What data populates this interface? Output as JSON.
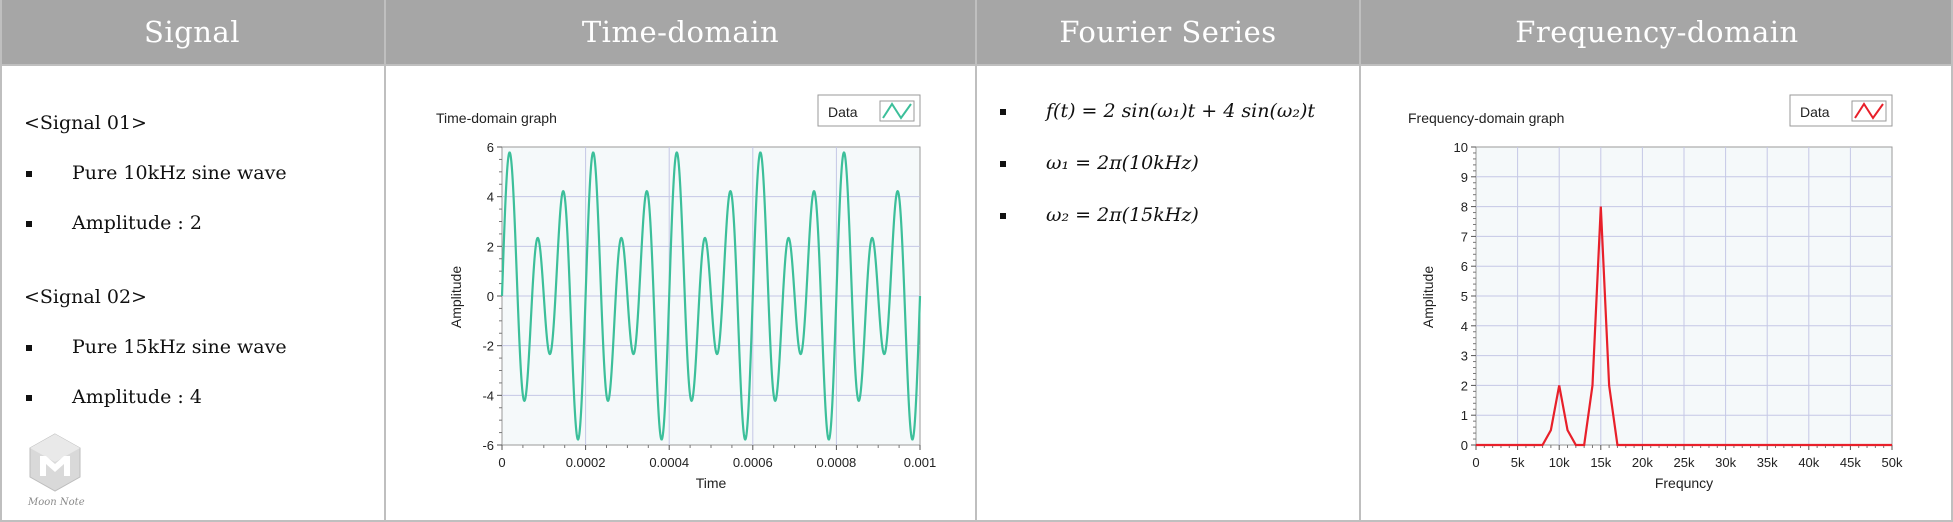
{
  "headers": {
    "signal": "Signal",
    "time_domain": "Time-domain",
    "fourier": "Fourier Series",
    "frequency_domain": "Frequency-domain"
  },
  "signals": {
    "s1_title": "<Signal 01>",
    "s1_items": [
      "Pure 10kHz sine wave",
      "Amplitude : 2"
    ],
    "s2_title": "<Signal 02>",
    "s2_items": [
      "Pure 15kHz sine wave",
      "Amplitude : 4"
    ]
  },
  "fourier": {
    "eq1": "f(t) = 2 sin(ω₁)t + 4 sin(ω₂)t",
    "eq2": "ω₁ = 2π(10kHz)",
    "eq3": "ω₂ = 2π(15kHz)"
  },
  "logo_text": "Moon Note",
  "colors": {
    "header_bg": "#a6a6a6",
    "time_series": "#3cbf9a",
    "freq_series": "#e8202a",
    "plot_bg": "#f5f9fa",
    "grid": "#c5c8e6"
  },
  "chart_data": [
    {
      "type": "line",
      "title": "Time-domain graph",
      "xlabel": "Time",
      "ylabel": "Amplitude",
      "xlim": [
        0,
        0.001
      ],
      "ylim": [
        -6,
        6
      ],
      "xticks": [
        "0",
        "0.0002",
        "0.0004",
        "0.0006",
        "0.0008",
        "0.001"
      ],
      "yticks": [
        "-6",
        "-4",
        "-2",
        "0",
        "2",
        "4",
        "6"
      ],
      "grid": true,
      "legend": {
        "label": "Data",
        "position": "top-right"
      },
      "series": [
        {
          "function": "2 sin(2π·10000·t) + 4 sin(2π·15000·t)",
          "amplitudes": [
            2,
            4
          ],
          "frequencies_hz": [
            10000,
            15000
          ]
        }
      ]
    },
    {
      "type": "line",
      "title": "Frequency-domain graph",
      "xlabel": "Frequncy",
      "ylabel": "Amplitude",
      "xlim": [
        0,
        50000
      ],
      "ylim": [
        0,
        10
      ],
      "xticks": [
        "0",
        "5k",
        "10k",
        "15k",
        "20k",
        "25k",
        "30k",
        "35k",
        "40k",
        "45k",
        "50k"
      ],
      "yticks": [
        "0",
        "1",
        "2",
        "3",
        "4",
        "5",
        "6",
        "7",
        "8",
        "9",
        "10"
      ],
      "grid": true,
      "legend": {
        "label": "Data",
        "position": "top-right"
      },
      "x": [
        0,
        8000,
        9000,
        10000,
        11000,
        12000,
        13000,
        14000,
        15000,
        16000,
        17000,
        50000
      ],
      "y": [
        0,
        0,
        0.5,
        2,
        0.5,
        0,
        0,
        2,
        8,
        2,
        0,
        0
      ]
    }
  ]
}
